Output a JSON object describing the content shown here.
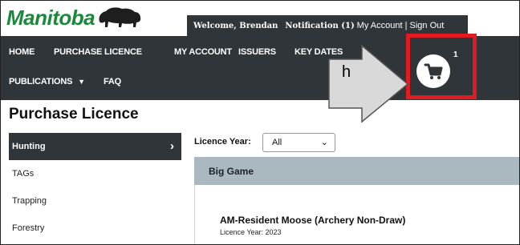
{
  "header": {
    "logo_text": "Manitoba",
    "welcome_text": "Welcome, Brendan",
    "notification_text": "Notification (1)",
    "account_links": "My Account | Sign Out"
  },
  "nav": {
    "items": [
      "HOME",
      "PURCHASE LICENCE",
      "MY ACCOUNT",
      "ISSUERS",
      "KEY DATES",
      "PUBLICATIONS",
      "FAQ"
    ],
    "dropdown_icon": "caret-down-icon"
  },
  "cart": {
    "icon": "shopping-cart-icon",
    "badge_count": "1",
    "highlight_color": "#e11b22"
  },
  "annotation": {
    "letter": "h"
  },
  "page": {
    "title": "Purchase Licence"
  },
  "sidebar": {
    "items": [
      {
        "label": "Hunting",
        "active": true
      },
      {
        "label": "TAGs",
        "active": false
      },
      {
        "label": "Trapping",
        "active": false
      },
      {
        "label": "Forestry",
        "active": false
      }
    ]
  },
  "filter": {
    "label": "Licence Year:",
    "selected": "All"
  },
  "section": {
    "title": "Big Game"
  },
  "licence": {
    "title": "AM-Resident Moose (Archery Non-Draw)",
    "year_text": "Licence Year: 2023"
  },
  "colors": {
    "nav_bg": "#2f3539",
    "brand_green": "#1a8a3a",
    "section_bg": "#aab8bf"
  }
}
